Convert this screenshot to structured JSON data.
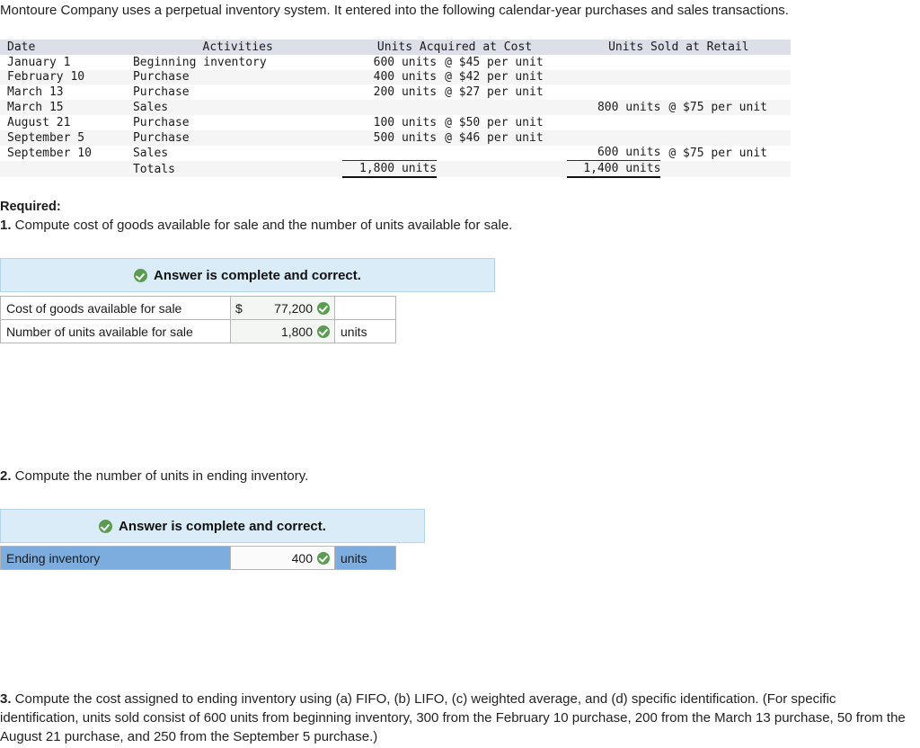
{
  "intro": "Montoure Company uses a perpetual inventory system. It entered into the following calendar-year purchases and sales transactions.",
  "txn_table": {
    "headers": {
      "date": "Date",
      "activities": "Activities",
      "acquired": "Units Acquired at Cost",
      "sold": "Units Sold at Retail"
    },
    "rows": [
      {
        "date": "January 1",
        "activity": "Beginning inventory",
        "acq_units": "600 units",
        "acq_price": "@ $45 per unit",
        "sold_units": "",
        "sold_price": ""
      },
      {
        "date": "February 10",
        "activity": "Purchase",
        "acq_units": "400 units",
        "acq_price": "@ $42 per unit",
        "sold_units": "",
        "sold_price": ""
      },
      {
        "date": "March 13",
        "activity": "Purchase",
        "acq_units": "200 units",
        "acq_price": "@ $27 per unit",
        "sold_units": "",
        "sold_price": ""
      },
      {
        "date": "March 15",
        "activity": "Sales",
        "acq_units": "",
        "acq_price": "",
        "sold_units": "800 units",
        "sold_price": "@ $75 per unit"
      },
      {
        "date": "August 21",
        "activity": "Purchase",
        "acq_units": "100 units",
        "acq_price": "@ $50 per unit",
        "sold_units": "",
        "sold_price": ""
      },
      {
        "date": "September 5",
        "activity": "Purchase",
        "acq_units": "500 units",
        "acq_price": "@ $46 per unit",
        "sold_units": "",
        "sold_price": ""
      },
      {
        "date": "September 10",
        "activity": "Sales",
        "acq_units": "",
        "acq_price": "",
        "sold_units": "600 units",
        "sold_price": "@ $75 per unit"
      }
    ],
    "totals": {
      "label": "Totals",
      "acquired": "1,800 units",
      "sold": "1,400 units"
    }
  },
  "required_heading": "Required:",
  "questions": {
    "q1_num": "1.",
    "q1_text": " Compute cost of goods available for sale and the number of units available for sale.",
    "q2_num": "2.",
    "q2_text": " Compute the number of units in ending inventory.",
    "q3_num": "3.",
    "q3_text": " Compute the cost assigned to ending inventory using (a) FIFO, (b) LIFO, (c) weighted average, and (d) specific identification. (For specific identification, units sold consist of 600 units from beginning inventory, 300 from the February 10 purchase, 200 from the March 13 purchase, 50 from the August 21 purchase, and 250 from the September 5 purchase.)"
  },
  "answer1": {
    "banner": "Answer is complete and correct.",
    "rows": [
      {
        "label": "Cost of goods available for sale",
        "currency": "$",
        "value": "77,200",
        "unit": ""
      },
      {
        "label": "Number of units available for sale",
        "currency": "",
        "value": "1,800",
        "unit": "units"
      }
    ]
  },
  "answer2": {
    "banner": "Answer is complete and correct.",
    "rows": [
      {
        "label": "Ending inventory",
        "currency": "",
        "value": "400",
        "unit": "units"
      }
    ]
  },
  "colors": {
    "banner_bg": "#d9ecf8",
    "banner_border": "#b6d4e8",
    "check_green": "#5c9c52",
    "table_header_bg": "#dcdfe8",
    "selected_blue": "#7cadde"
  }
}
